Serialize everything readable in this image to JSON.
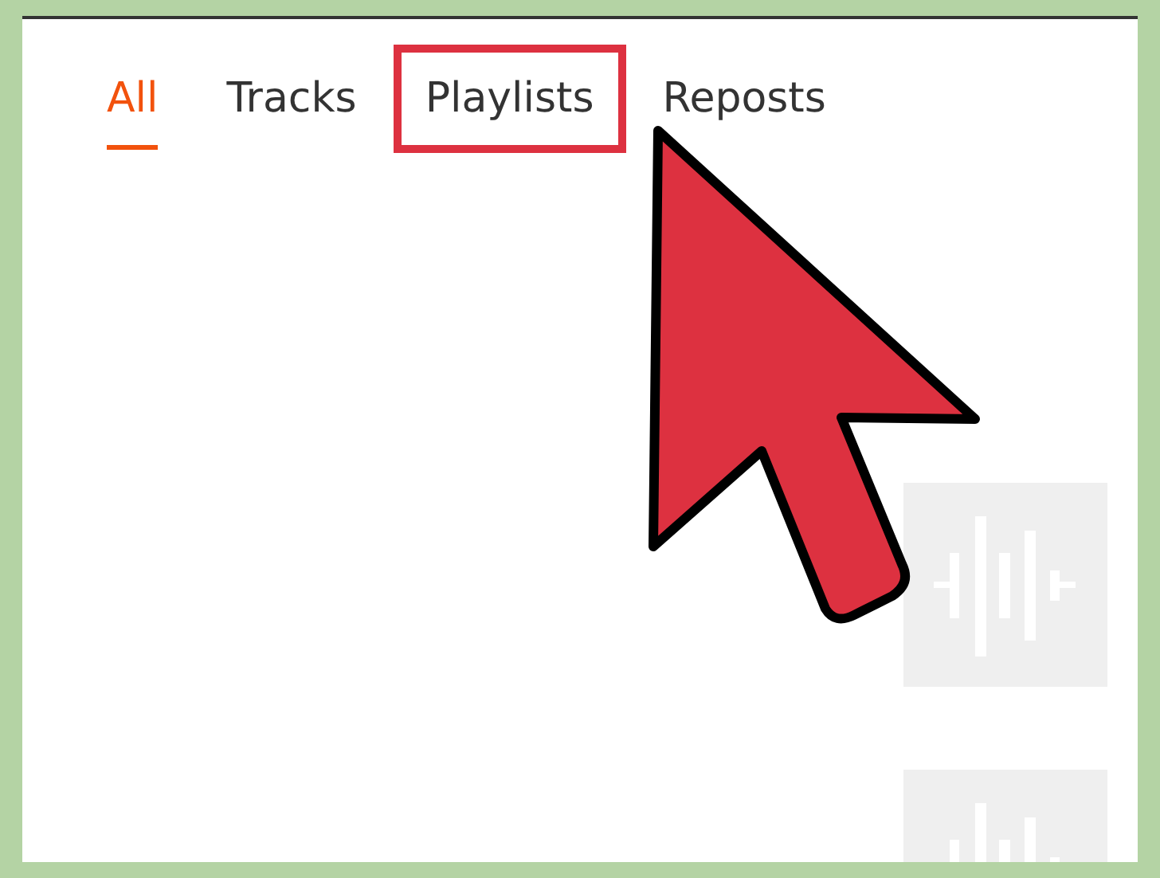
{
  "tabs": [
    {
      "label": "All",
      "selected": true,
      "highlighted": false
    },
    {
      "label": "Tracks",
      "selected": false,
      "highlighted": false
    },
    {
      "label": "Playlists",
      "selected": false,
      "highlighted": true
    },
    {
      "label": "Reposts",
      "selected": false,
      "highlighted": false
    }
  ],
  "cursor": {
    "shown": true
  }
}
